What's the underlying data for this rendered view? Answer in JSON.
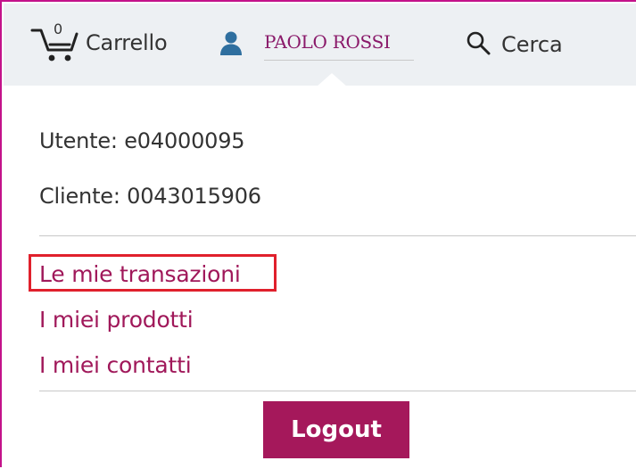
{
  "header": {
    "cart": {
      "count": "0",
      "label": "Carrello",
      "icon": "cart-icon"
    },
    "user": {
      "name": "PAOLO ROSSI",
      "icon": "user-icon"
    },
    "search": {
      "label": "Cerca",
      "icon": "search-icon"
    }
  },
  "account": {
    "utente": "Utente: e04000095",
    "cliente": "Cliente: 0043015906"
  },
  "menu": {
    "items": [
      {
        "label": "Le mie transazioni",
        "highlighted": true
      },
      {
        "label": "I miei prodotti",
        "highlighted": false
      },
      {
        "label": "I miei contatti",
        "highlighted": false
      }
    ]
  },
  "logout_label": "Logout",
  "colors": {
    "accent": "#a5185b",
    "link": "#a0185a",
    "highlight_border": "#e0202c",
    "frame_border": "#c3128a",
    "header_bg": "#edf0f3",
    "user_icon": "#2f6f9f"
  }
}
